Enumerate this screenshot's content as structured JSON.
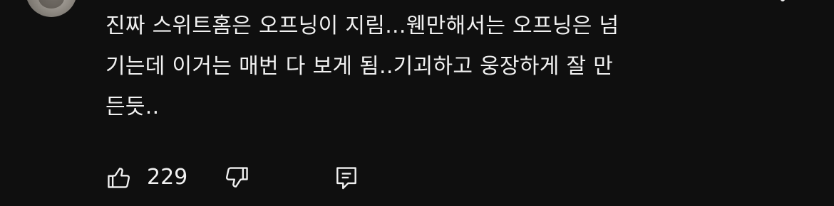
{
  "comment": {
    "text": "진짜 스위트홈은 오프닝이 지림...웬만해서는 오프닝은 넘\n기는데 이거는 매번 다 보게 됨..기괴하고 웅장하게 잘 만\n든듯..",
    "like_count": "229"
  },
  "icons": {
    "like": "thumbs-up-icon",
    "dislike": "thumbs-down-icon",
    "reply": "comment-reply-icon",
    "more": "more-options-icon"
  },
  "colors": {
    "background": "#0f0f0f",
    "text": "#f1f1f1"
  }
}
